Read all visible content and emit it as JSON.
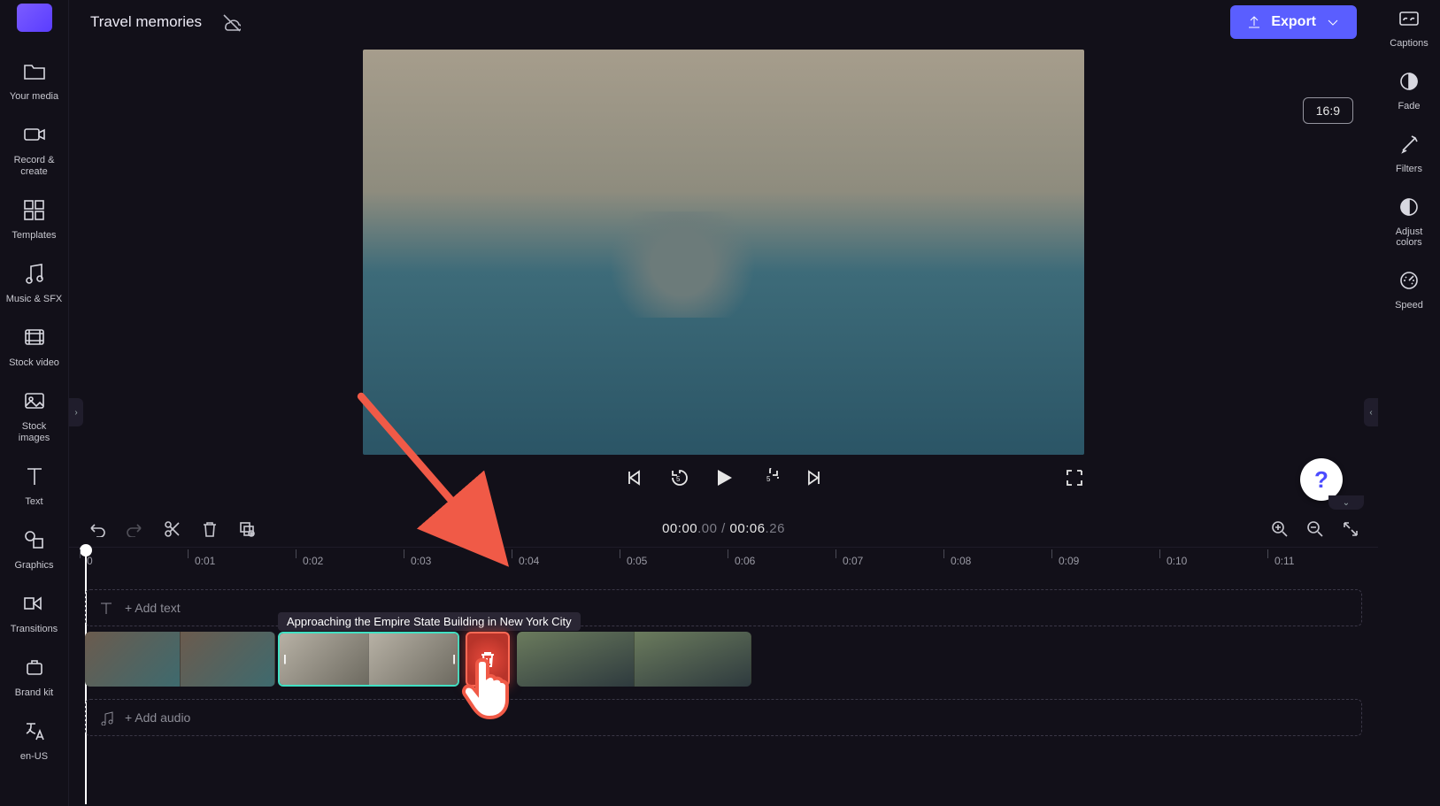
{
  "header": {
    "title": "Travel memories",
    "export_label": "Export"
  },
  "preview": {
    "aspect_ratio": "16:9"
  },
  "left_rail": {
    "your_media": "Your media",
    "record_create": "Record &\ncreate",
    "templates": "Templates",
    "music_sfx": "Music & SFX",
    "stock_video": "Stock video",
    "stock_images": "Stock\nimages",
    "text": "Text",
    "graphics": "Graphics",
    "transitions": "Transitions",
    "brand_kit": "Brand kit",
    "locale": "en-US"
  },
  "right_rail": {
    "captions": "Captions",
    "fade": "Fade",
    "filters": "Filters",
    "adjust_colors": "Adjust\ncolors",
    "speed": "Speed"
  },
  "playback": {
    "current_time_main": "00:00",
    "current_time_frames": ".00",
    "separator": " / ",
    "total_time_main": "00:06",
    "total_time_frames": ".26"
  },
  "ruler": {
    "marks": [
      "0",
      "0:01",
      "0:02",
      "0:03",
      "0:04",
      "0:05",
      "0:06",
      "0:07",
      "0:08",
      "0:09",
      "0:10",
      "0:11"
    ]
  },
  "tracks": {
    "add_text": "+ Add text",
    "add_audio": "+ Add audio",
    "clip_tooltip": "Approaching the Empire State Building in New York City"
  },
  "colors": {
    "accent": "#5a5eff",
    "highlight_ring": "#42e0c3",
    "annotation": "#f05a47"
  }
}
